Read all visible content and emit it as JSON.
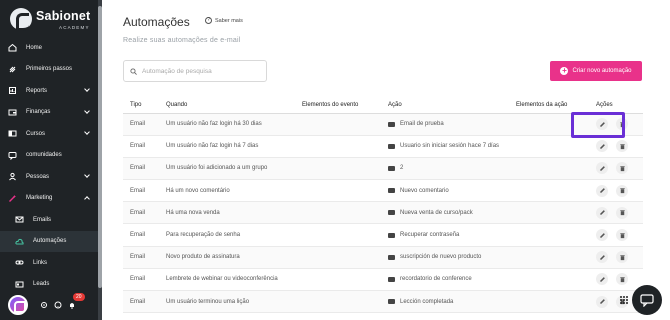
{
  "brand": {
    "name": "Sabionet",
    "sub": "ACADEMY"
  },
  "sidebar": {
    "items": [
      {
        "label": "Home",
        "icon": "home-icon",
        "chevron": false
      },
      {
        "label": "Primeiros passos",
        "icon": "rocket-icon",
        "chevron": false
      },
      {
        "label": "Reports",
        "icon": "chart-icon",
        "chevron": true
      },
      {
        "label": "Finanças",
        "icon": "wallet-icon",
        "chevron": true
      },
      {
        "label": "Cursos",
        "icon": "course-icon",
        "chevron": true
      },
      {
        "label": "comunidades",
        "icon": "chat-icon",
        "chevron": false
      },
      {
        "label": "Pessoas",
        "icon": "people-icon",
        "chevron": true
      },
      {
        "label": "Marketing",
        "icon": "magic-wand-icon",
        "chevron": "up"
      },
      {
        "label": "Emails",
        "icon": "mail-icon",
        "sub": true
      },
      {
        "label": "Automações",
        "icon": "cloud-icon",
        "sub": true,
        "active": true
      },
      {
        "label": "Links",
        "icon": "link-icon",
        "sub": true
      },
      {
        "label": "Leads",
        "icon": "card-icon",
        "sub": true
      }
    ],
    "badge": "20"
  },
  "header": {
    "title": "Automações",
    "saber_mais": "Saber mais",
    "subtitle": "Realize suas automações de e-mail"
  },
  "search": {
    "placeholder": "Automação de pesquisa"
  },
  "create_button": "Criar novo automação",
  "table": {
    "headers": [
      "Tipo",
      "Quando",
      "Elementos do evento",
      "Ação",
      "Elementos da ação",
      "Ações"
    ],
    "rows": [
      {
        "tipo": "Email",
        "quando": "Um usuário não faz login há 30 dias",
        "acao": "Email de prueba"
      },
      {
        "tipo": "Email",
        "quando": "Um usuário não faz login há 7 dias",
        "acao": "Usuario sin iniciar sesión hace 7 días"
      },
      {
        "tipo": "Email",
        "quando": "Um usuário foi adicionado a um grupo",
        "acao": "2"
      },
      {
        "tipo": "Email",
        "quando": "Há um novo comentário",
        "acao": "Nuevo comentario"
      },
      {
        "tipo": "Email",
        "quando": "Há uma nova venda",
        "acao": "Nueva venta de curso/pack"
      },
      {
        "tipo": "Email",
        "quando": "Para recuperação de senha",
        "acao": "Recuperar contraseña"
      },
      {
        "tipo": "Email",
        "quando": "Novo produto de assinatura",
        "acao": "suscripción de nuevo producto"
      },
      {
        "tipo": "Email",
        "quando": "Lembrete de webinar ou videoconferência",
        "acao": "recordatorio de conference"
      },
      {
        "tipo": "Email",
        "quando": "Um usuário terminou uma lição",
        "acao": "Lección completada"
      }
    ]
  },
  "colors": {
    "accent": "#e9328a",
    "sidebar": "#1f2326",
    "highlight": "#6a2fd6",
    "active_icon": "#46c6a3"
  }
}
